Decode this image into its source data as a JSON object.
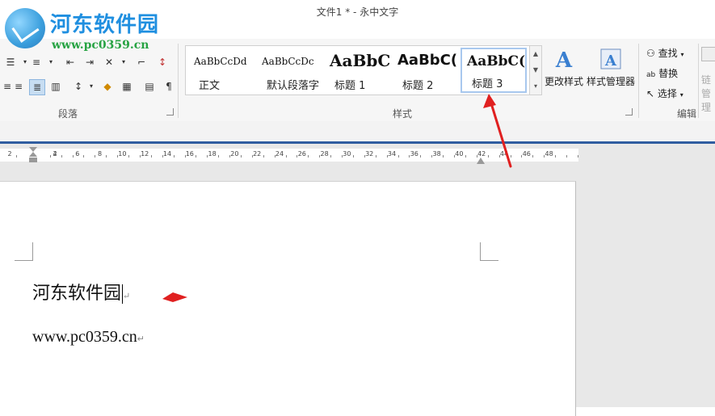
{
  "window": {
    "title": "文件1 * - 永中文字"
  },
  "watermark": {
    "site_name": "河东软件园",
    "site_url": "www.pc0359.cn"
  },
  "ribbon": {
    "paragraph_group": {
      "label": "段落"
    },
    "styles_group": {
      "label": "样式",
      "items": [
        {
          "preview": "AaBbCcDd",
          "name": "正文"
        },
        {
          "preview": "AaBbCcDc",
          "name": "默认段落字"
        },
        {
          "preview": "AaBbC",
          "name": "标题 1"
        },
        {
          "preview": "AaBbC(",
          "name": "标题 2"
        },
        {
          "preview": "AaBbC(",
          "name": "标题 3"
        }
      ],
      "change_style_label": "更改样式",
      "style_manager_label": "样式管理器"
    },
    "edit_group": {
      "label": "编辑",
      "find_label": "查找",
      "replace_label": "替换",
      "select_label": "选择",
      "link_label": "链",
      "manage_label": "管理"
    }
  },
  "ruler": {
    "labels": [
      "2",
      "2",
      "4",
      "6",
      "8",
      "10",
      "12",
      "14",
      "16",
      "18",
      "20",
      "22",
      "24",
      "26",
      "28",
      "30",
      "32",
      "34",
      "36",
      "38",
      "40",
      "42",
      "44",
      "46",
      "48"
    ]
  },
  "document": {
    "line1": "河东软件园",
    "line2": "www.pc0359.cn"
  },
  "colors": {
    "accent_blue": "#2f5da0",
    "selected_style_border": "#a8c8ee",
    "annotation_red": "#e02020"
  }
}
